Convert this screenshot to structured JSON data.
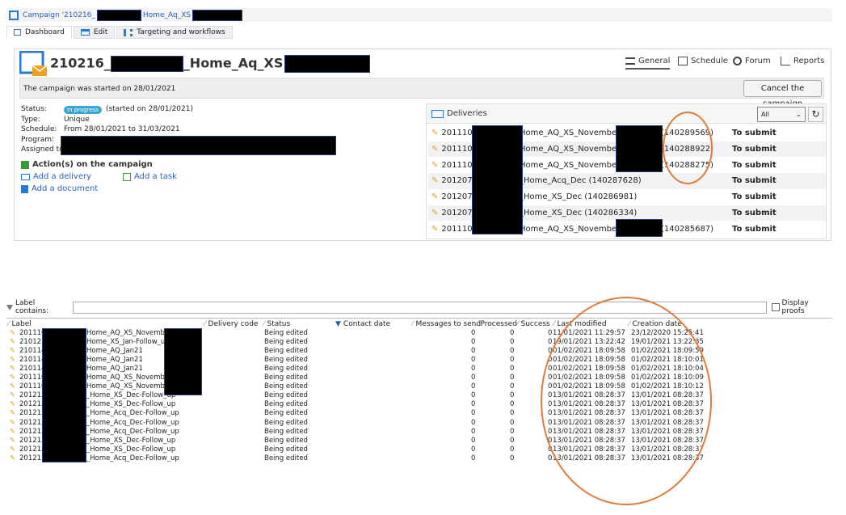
{
  "breadcrumb": {
    "prefix": "Campaign '210216_",
    "suffix": "Home_Aq_XS"
  },
  "tabs": [
    {
      "label": "Dashboard"
    },
    {
      "label": "Edit"
    },
    {
      "label": "Targeting and workflows"
    }
  ],
  "campaign": {
    "title_prefix": "210216_",
    "title_suffix": "_Home_Aq_XS",
    "started_text": "The campaign was started on 28/01/2021",
    "cancel_label": "Cancel the campaign",
    "views": [
      {
        "label": "General"
      },
      {
        "label": "Schedule"
      },
      {
        "label": "Forum"
      },
      {
        "label": "Reports"
      }
    ],
    "status_key": "Status:",
    "status_badge": "In progress",
    "status_text": "(started on 28/01/2021)",
    "type_key": "Type:",
    "type_value": "Unique",
    "schedule_key": "Schedule:",
    "schedule_value": "From 28/01/2021 to 31/03/2021",
    "program_key": "Program:",
    "assigned_key": "Assigned to",
    "actions_title": "Action(s) on the campaign",
    "add_delivery": "Add a delivery",
    "add_task": "Add a task",
    "add_document": "Add a document"
  },
  "deliveries": {
    "title": "Deliveries",
    "filter_value": "All",
    "rows": [
      {
        "a": "201110_",
        "b": "Home_AQ_XS_November -",
        "id": "(140289569)",
        "status": "To submit"
      },
      {
        "a": "201110_",
        "b": "Home_AQ_XS_November -",
        "id": "(140288922)",
        "status": "To submit"
      },
      {
        "a": "201110_",
        "b": "Home_AQ_XS_November -",
        "id": "(140288275)",
        "status": "To submit"
      },
      {
        "a": "201207_",
        "b": "_Home_Acq_Dec (140287628)",
        "id": "",
        "status": "To submit"
      },
      {
        "a": "201207_",
        "b": "_Home_XS_Dec (140286981)",
        "id": "",
        "status": "To submit"
      },
      {
        "a": "201207_",
        "b": "_Home_XS_Dec (140286334)",
        "id": "",
        "status": "To submit"
      },
      {
        "a": "201110_",
        "b": "Home_AQ_XS_November -",
        "id": "(140285687)",
        "status": "To submit"
      }
    ]
  },
  "list": {
    "filter_label": "Label contains:",
    "display_proofs": "Display proofs",
    "columns": [
      "Label",
      "Delivery code",
      "Status",
      "Contact date",
      "Messages to send",
      "Processed",
      "Success",
      "Last modified",
      "Creation date"
    ],
    "rows": [
      {
        "a": "201110_",
        "b": "Home_AQ_XS_November",
        "status": "Being edited",
        "m": "0",
        "p": "0",
        "s": "0",
        "lm": "11/01/2021 11:29:57",
        "cd": "23/12/2020 15:25:41"
      },
      {
        "a": "210121_",
        "b": "Home_XS_Jan-Follow_up",
        "status": "Being edited",
        "m": "0",
        "p": "0",
        "s": "0",
        "lm": "19/01/2021 13:22:42",
        "cd": "19/01/2021 13:22:35"
      },
      {
        "a": "210114_",
        "b": "Home_AQ_Jan21",
        "status": "Being edited",
        "m": "0",
        "p": "0",
        "s": "0",
        "lm": "01/02/2021 18:09:58",
        "cd": "01/02/2021 18:09:59"
      },
      {
        "a": "210114_",
        "b": "Home_AQ_Jan21",
        "status": "Being edited",
        "m": "0",
        "p": "0",
        "s": "0",
        "lm": "01/02/2021 18:09:58",
        "cd": "01/02/2021 18:10:01"
      },
      {
        "a": "210114_",
        "b": "Home_AQ_Jan21",
        "status": "Being edited",
        "m": "0",
        "p": "0",
        "s": "0",
        "lm": "01/02/2021 18:09:58",
        "cd": "01/02/2021 18:10:04"
      },
      {
        "a": "201110_",
        "b": "Home_AQ_XS_November",
        "status": "Being edited",
        "m": "0",
        "p": "0",
        "s": "0",
        "lm": "01/02/2021 18:09:58",
        "cd": "01/02/2021 18:10:09"
      },
      {
        "a": "201110_",
        "b": "Home_AQ_XS_November",
        "status": "Being edited",
        "m": "0",
        "p": "0",
        "s": "0",
        "lm": "01/02/2021 18:09:58",
        "cd": "01/02/2021 18:10:12"
      },
      {
        "a": "201215_",
        "b": "_Home_XS_Dec-Follow_up",
        "status": "Being edited",
        "m": "0",
        "p": "0",
        "s": "0",
        "lm": "13/01/2021 08:28:37",
        "cd": "13/01/2021 08:28:37"
      },
      {
        "a": "201215_",
        "b": "_Home_XS_Dec-Follow_up",
        "status": "Being edited",
        "m": "0",
        "p": "0",
        "s": "0",
        "lm": "13/01/2021 08:28:37",
        "cd": "13/01/2021 08:28:37"
      },
      {
        "a": "201215_",
        "b": "_Home_Acq_Dec-Follow_up",
        "status": "Being edited",
        "m": "0",
        "p": "0",
        "s": "0",
        "lm": "13/01/2021 08:28:37",
        "cd": "13/01/2021 08:28:37"
      },
      {
        "a": "201215_",
        "b": "_Home_Acq_Dec-Follow_up",
        "status": "Being edited",
        "m": "0",
        "p": "0",
        "s": "0",
        "lm": "13/01/2021 08:28:37",
        "cd": "13/01/2021 08:28:37"
      },
      {
        "a": "201215_",
        "b": "_Home_Acq_Dec-Follow_up",
        "status": "Being edited",
        "m": "0",
        "p": "0",
        "s": "0",
        "lm": "13/01/2021 08:28:37",
        "cd": "13/01/2021 08:28:37"
      },
      {
        "a": "201215_",
        "b": "_Home_XS_Dec-Follow_up",
        "status": "Being edited",
        "m": "0",
        "p": "0",
        "s": "0",
        "lm": "13/01/2021 08:28:37",
        "cd": "13/01/2021 08:28:37"
      },
      {
        "a": "201215_",
        "b": "_Home_XS_Dec-Follow_up",
        "status": "Being edited",
        "m": "0",
        "p": "0",
        "s": "0",
        "lm": "13/01/2021 08:28:37",
        "cd": "13/01/2021 08:28:37"
      },
      {
        "a": "201215_",
        "b": "_Home_Acq_Dec-Follow_up",
        "status": "Being edited",
        "m": "0",
        "p": "0",
        "s": "0",
        "lm": "13/01/2021 08:28:37",
        "cd": "13/01/2021 08:28:37"
      }
    ]
  },
  "colors": {
    "accent": "#2b78d0",
    "badge": "#37a6d6",
    "annotation": "#e07b39",
    "mail": "#f0a020"
  }
}
